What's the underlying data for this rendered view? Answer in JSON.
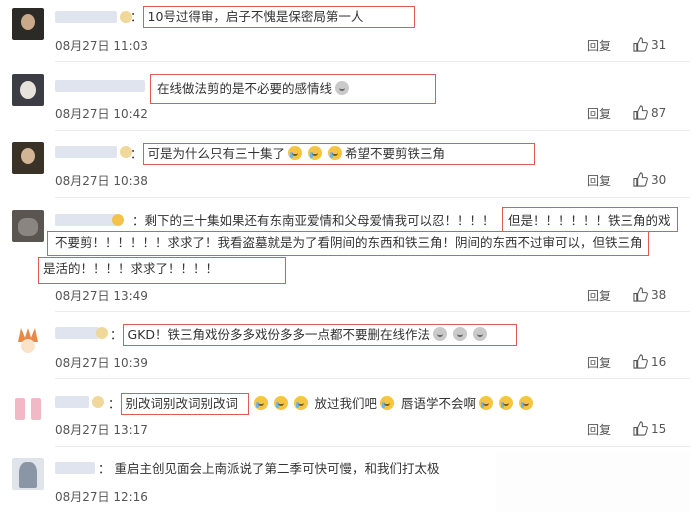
{
  "comments": [
    {
      "text": "10号过得审，启子不愧是保密局第一人",
      "time": "08月27日 11:03",
      "reply": "回复",
      "likes": "31",
      "avatar_color": "#2b2a26"
    },
    {
      "text": "在线做法剪的是不必要的感情线",
      "time": "08月27日 10:42",
      "reply": "回复",
      "likes": "87",
      "avatar_color": "#3b3c44"
    },
    {
      "text": "可是为什么只有三十集了",
      "text2": "希望不要剪铁三角",
      "time": "08月27日 10:38",
      "reply": "回复",
      "likes": "30",
      "avatar_color": "#3a3226"
    },
    {
      "line1": "剩下的三十集如果还有东南亚爱情和父母爱情我可以忍！！！！",
      "line1_hl": "但是！！！！！！铁三角的戏",
      "line2": "不要剪！！！！！！求求了！我看盗墓就是为了看阴间的东西和铁三角！阴间的东西不过审可以，但铁三角",
      "line3": "是活的！！！！求求了！！！！",
      "time": "08月27日 13:49",
      "reply": "回复",
      "likes": "38",
      "avatar_color": "#5a5550"
    },
    {
      "text": "GKD！铁三角戏份多多戏份多多一点都不要删在线作法",
      "time": "08月27日 10:39",
      "reply": "回复",
      "likes": "16",
      "avatar_color": "#e8894a"
    },
    {
      "text_hl": "别改词别改词别改词",
      "text2": "放过我们吧",
      "text3": "唇语学不会啊",
      "time": "08月27日 13:17",
      "reply": "回复",
      "likes": "15",
      "avatar_color": "#f2b8c6"
    },
    {
      "text": "重启主创见面会上南派说了第二季可快可慢，和我们打太极",
      "time": "08月27日 12:16",
      "avatar_color": "#8a95a6"
    }
  ],
  "colors": {
    "highlight_border": "#e05a5a",
    "meta_text": "#555555",
    "divider": "#ececec"
  },
  "icons": {
    "like": "thumbs-up-icon",
    "verified": "verified-badge-icon",
    "emoji": "emoji-icon"
  }
}
